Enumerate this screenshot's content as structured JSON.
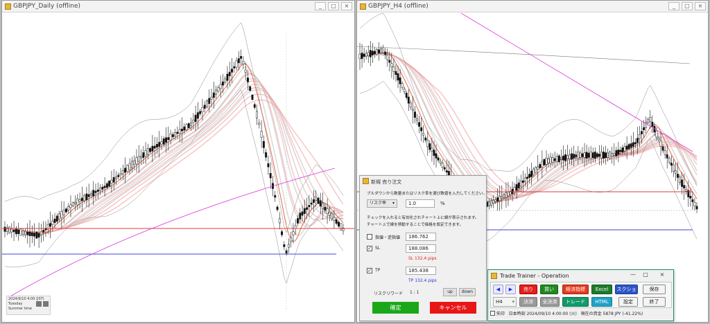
{
  "colors": {
    "candle": "#111111",
    "red_line": "#e23a3a",
    "blue_line": "#3c46d8",
    "magenta_line": "#dd33dd",
    "ma_grey": "#bfbfbf",
    "ma_pink": "#f2a0a0",
    "ma_red": "#e8532f",
    "confirm_green": "#1aa81a",
    "cancel_red": "#e81616",
    "sl_text": "#e02020",
    "tp_text": "#2235d8"
  },
  "left_window": {
    "title": "GBPJPY_Daily (offline)",
    "buttons": [
      "_",
      "□",
      "×"
    ],
    "info_lines": [
      "2024/9/10 4:00 (JST)",
      "Tuesday",
      "Summer time"
    ],
    "info_extra": "JST"
  },
  "right_window": {
    "title": "GBPJPY_H4 (offline)",
    "buttons": [
      "_",
      "□",
      "×"
    ]
  },
  "order_dialog": {
    "title": "新規 売り注文",
    "instruction": "プルダウンから数量またはリスク率を選び数値を入力してください。",
    "risk_select": "リスク率",
    "risk_value": "1.0",
    "risk_unit": "%",
    "hint_line1": "チェックを入れると有効化されチャート上に線が表示されます。",
    "hint_line2": "チャート上で線を移動することで価格を設定できます。",
    "limit_label": "指値・逆指値",
    "limit_value": "186.762",
    "sl_label": "SL",
    "sl_value": "188.086",
    "sl_pips": "SL 132.4 pips",
    "tp_label": "TP",
    "tp_value": "185.438",
    "tp_pips": "TP 132.4 pips",
    "rr_label": "リスクリワード",
    "rr_value": "1 : 1",
    "up_label": "up",
    "down_label": "down",
    "confirm_label": "確定",
    "cancel_label": "キャンセル"
  },
  "trainer": {
    "title": "Trade Trainer - Operation",
    "window_controls": [
      "—",
      "□",
      "×"
    ],
    "prev_icon": "◀",
    "next_icon": "▶",
    "sell": "売り",
    "buy": "買い",
    "econ": "経済指標",
    "excel": "Excel",
    "screenshot": "スクショ",
    "save": "保存",
    "timeframe": "H4",
    "settle": "決済",
    "settle_all": "全決済",
    "trade": "トレード",
    "html": "HTML",
    "settings": "設定",
    "quit": "終了",
    "mark_label": "矢印",
    "time_label": "日本時刻",
    "time_value": "2024/09/10 4:00:00 (火)",
    "balance_label": "現在の資金",
    "balance_value": "5878 JPY (-41.22%)"
  }
}
